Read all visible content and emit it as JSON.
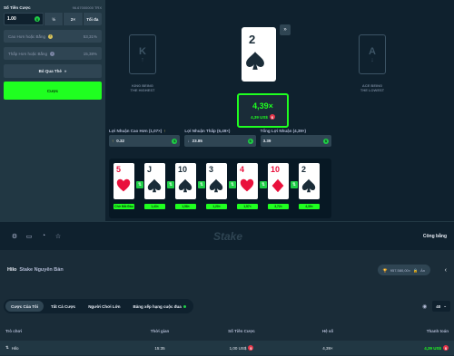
{
  "sidebar": {
    "bet_label": "Số Tiền Cược",
    "bet_sub": "96.67000000 TRX",
    "bet_value": "1.00",
    "half_label": "½",
    "double_label": "2×",
    "max_label": "Tối đa",
    "higher_label": "Cao Hơn hoặc Bằng",
    "higher_pct": "53,31%",
    "lower_label": "Thấp Hơn hoặc Bằng",
    "lower_pct": "15,38%",
    "skip_label": "Bỏ Qua Thẻ",
    "bet_button": "Cược"
  },
  "game": {
    "left_card_rank": "K",
    "left_caption_1": "KING BEING",
    "left_caption_2": "THE HIGHEST",
    "right_card_rank": "A",
    "right_caption_1": "ACE BEING",
    "right_caption_2": "THE LOWEST",
    "current_rank": "2",
    "skip_icon": "»",
    "multiplier": "4,39×",
    "payout": "4,39 US$"
  },
  "profits": [
    {
      "label": "Lợi Nhuận Cao Hơn (1,07×)",
      "icon": "↑",
      "value": "0.32"
    },
    {
      "label": "Lợi Nhuận Thấp (6,49×)",
      "icon": "↓",
      "value": "23.85"
    },
    {
      "label": "Tổng Lợi Nhuận (4,39×)",
      "icon": "",
      "value": "3.39"
    }
  ],
  "history": [
    {
      "rank": "5",
      "suit": "heart",
      "color": "#e9113c",
      "badge": "Chờ Bắt Đầu"
    },
    {
      "rank": "J",
      "suit": "spade",
      "color": "#1a2c38",
      "badge": "1,43×"
    },
    {
      "rank": "10",
      "suit": "spade",
      "color": "#1a2c38",
      "badge": "1,58×"
    },
    {
      "rank": "3",
      "suit": "spade",
      "color": "#1a2c38",
      "badge": "1,20×"
    },
    {
      "rank": "4",
      "suit": "heart",
      "color": "#e9113c",
      "badge": "1,57×"
    },
    {
      "rank": "10",
      "suit": "diamond",
      "color": "#e9113c",
      "badge": "3,72×"
    },
    {
      "rank": "2",
      "suit": "spade",
      "color": "#1a2c38",
      "badge": "4,39×"
    }
  ],
  "toolbar": {
    "logo": "Stake",
    "fairness": "Công bằng"
  },
  "info": {
    "game_name": "Hilo",
    "provider": "Stake Nguyên Bản",
    "badge_value": "957.580,00×",
    "badge_hidden": "Ẩn"
  },
  "tabs": [
    {
      "label": "Cược Của Tôi",
      "active": true
    },
    {
      "label": "Tất Cả Cược",
      "active": false
    },
    {
      "label": "Người Chơi Lớn",
      "active": false
    },
    {
      "label": "Bảng xếp hạng cuộc đua",
      "active": false
    }
  ],
  "rows_select": "40",
  "table": {
    "headers": [
      "Trò chơi",
      "Thời gian",
      "Số Tiền Cược",
      "Hệ số",
      "Thanh toán"
    ],
    "rows": [
      {
        "game": "Hilo",
        "time": "15:35",
        "amount": "1,00 US$",
        "multiplier": "4,39×",
        "payout": "4,39 US$"
      }
    ]
  }
}
